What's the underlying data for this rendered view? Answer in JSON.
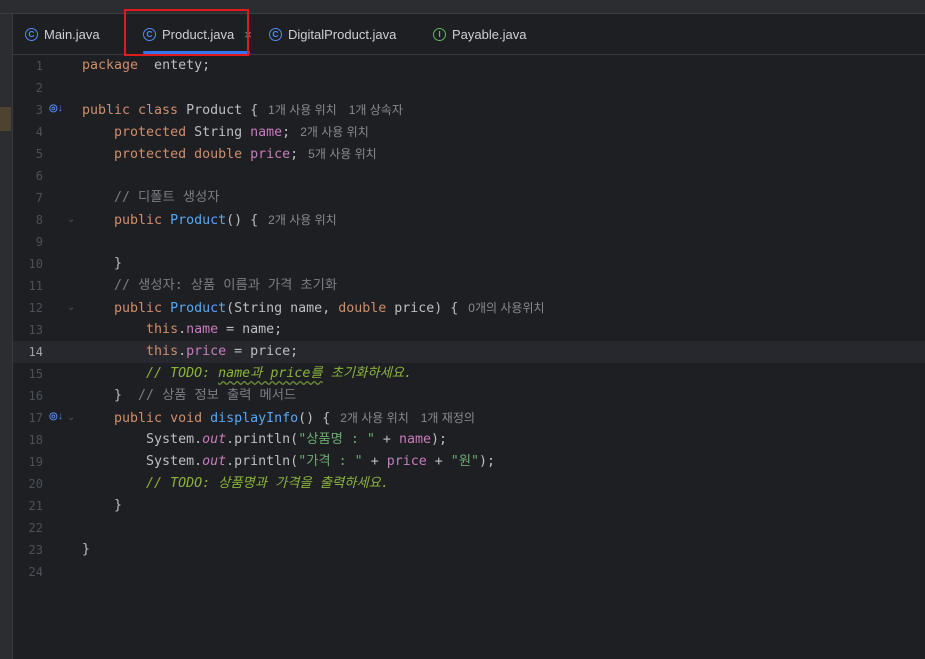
{
  "tabs": [
    {
      "label": "Main.java",
      "icon": "main-class-icon"
    },
    {
      "label": "Product.java",
      "icon": "class-icon",
      "active": true
    },
    {
      "label": "DigitalProduct.java",
      "icon": "class-icon"
    },
    {
      "label": "Payable.java",
      "icon": "interface-icon"
    }
  ],
  "close_glyph": "×",
  "lines": [
    {
      "n": "1",
      "segs": [
        [
          "kw",
          "package"
        ],
        [
          "",
          "  entety;"
        ]
      ]
    },
    {
      "n": "2",
      "segs": []
    },
    {
      "n": "3",
      "segs": [
        [
          "kw",
          "public class "
        ],
        [
          "",
          "Product {"
        ]
      ],
      "hints": [
        "1개 사용 위치",
        "1개 상속자"
      ],
      "gutter": true
    },
    {
      "n": "4",
      "segs": [
        [
          "",
          "    "
        ],
        [
          "kw",
          "protected "
        ],
        [
          "",
          "String "
        ],
        [
          "fld",
          "name"
        ],
        [
          "",
          ";"
        ]
      ],
      "hints": [
        "2개 사용 위치"
      ]
    },
    {
      "n": "5",
      "segs": [
        [
          "",
          "    "
        ],
        [
          "kw",
          "protected double "
        ],
        [
          "fld",
          "price"
        ],
        [
          "",
          ";"
        ]
      ],
      "hints": [
        "5개 사용 위치"
      ]
    },
    {
      "n": "6",
      "segs": []
    },
    {
      "n": "7",
      "segs": [
        [
          "",
          "    "
        ],
        [
          "cm",
          "// 디폴트 생성자"
        ]
      ]
    },
    {
      "n": "8",
      "segs": [
        [
          "",
          "    "
        ],
        [
          "kw",
          "public "
        ],
        [
          "fn",
          "Product"
        ],
        [
          "",
          "() {"
        ]
      ],
      "hints": [
        "2개 사용 위치"
      ],
      "fold": true
    },
    {
      "n": "9",
      "segs": []
    },
    {
      "n": "10",
      "segs": [
        [
          "",
          "    }"
        ]
      ]
    },
    {
      "n": "11",
      "segs": [
        [
          "",
          "    "
        ],
        [
          "cm",
          "// 생성자: 상품 이름과 가격 초기화"
        ]
      ]
    },
    {
      "n": "12",
      "segs": [
        [
          "",
          "    "
        ],
        [
          "kw",
          "public "
        ],
        [
          "fn",
          "Product"
        ],
        [
          "",
          "(String name, "
        ],
        [
          "kw",
          "double "
        ],
        [
          "",
          "price) {"
        ]
      ],
      "hints": [
        "0개의 사용위치"
      ],
      "fold": true
    },
    {
      "n": "13",
      "segs": [
        [
          "",
          "        "
        ],
        [
          "kw",
          "this"
        ],
        [
          "",
          "."
        ],
        [
          "fld",
          "name"
        ],
        [
          "",
          " = name;"
        ]
      ]
    },
    {
      "n": "14",
      "segs": [
        [
          "",
          "        "
        ],
        [
          "kw",
          "this"
        ],
        [
          "",
          "."
        ],
        [
          "fld",
          "price"
        ],
        [
          "",
          " = price;"
        ]
      ],
      "current": true
    },
    {
      "n": "15",
      "segs": [
        [
          "",
          "        "
        ],
        [
          "todo",
          "// TODO: "
        ],
        [
          "todo ul",
          "name과 price를"
        ],
        [
          "todo",
          " 초기화하세요."
        ]
      ]
    },
    {
      "n": "16",
      "segs": [
        [
          "",
          "    }  "
        ],
        [
          "cm",
          "// 상품 정보 출력 메서드"
        ]
      ]
    },
    {
      "n": "17",
      "segs": [
        [
          "",
          "    "
        ],
        [
          "kw",
          "public void "
        ],
        [
          "fn",
          "displayInfo"
        ],
        [
          "",
          "() {"
        ]
      ],
      "hints": [
        "2개 사용 위치",
        "1개 재정의"
      ],
      "gutter": true,
      "fold": true
    },
    {
      "n": "18",
      "segs": [
        [
          "",
          "        System."
        ],
        [
          "it",
          "out"
        ],
        [
          "",
          ".println("
        ],
        [
          "st",
          "\"상품명 : \""
        ],
        [
          "",
          " + "
        ],
        [
          "fld",
          "name"
        ],
        [
          "",
          ");"
        ]
      ]
    },
    {
      "n": "19",
      "segs": [
        [
          "",
          "        System."
        ],
        [
          "it",
          "out"
        ],
        [
          "",
          ".println("
        ],
        [
          "st",
          "\"가격 : \""
        ],
        [
          "",
          " + "
        ],
        [
          "fld",
          "price"
        ],
        [
          "",
          " + "
        ],
        [
          "st",
          "\"원\""
        ],
        [
          "",
          ");"
        ]
      ]
    },
    {
      "n": "20",
      "segs": [
        [
          "",
          "        "
        ],
        [
          "todo",
          "// TODO: 상품명과 가격을 출력하세요."
        ]
      ]
    },
    {
      "n": "21",
      "segs": [
        [
          "",
          "    }"
        ]
      ]
    },
    {
      "n": "22",
      "segs": []
    },
    {
      "n": "23",
      "segs": [
        [
          "",
          "}"
        ]
      ]
    },
    {
      "n": "24",
      "segs": []
    }
  ],
  "gutter_glyph": "◎↓",
  "fold_glyph": "⌄",
  "colors": {
    "background": "#1e1f22",
    "keyword": "#cf8e6d",
    "method": "#56a8f5",
    "field": "#c77dbb",
    "string": "#6aab73",
    "todo": "#8bb33d",
    "highlight": "#e01b1b"
  }
}
